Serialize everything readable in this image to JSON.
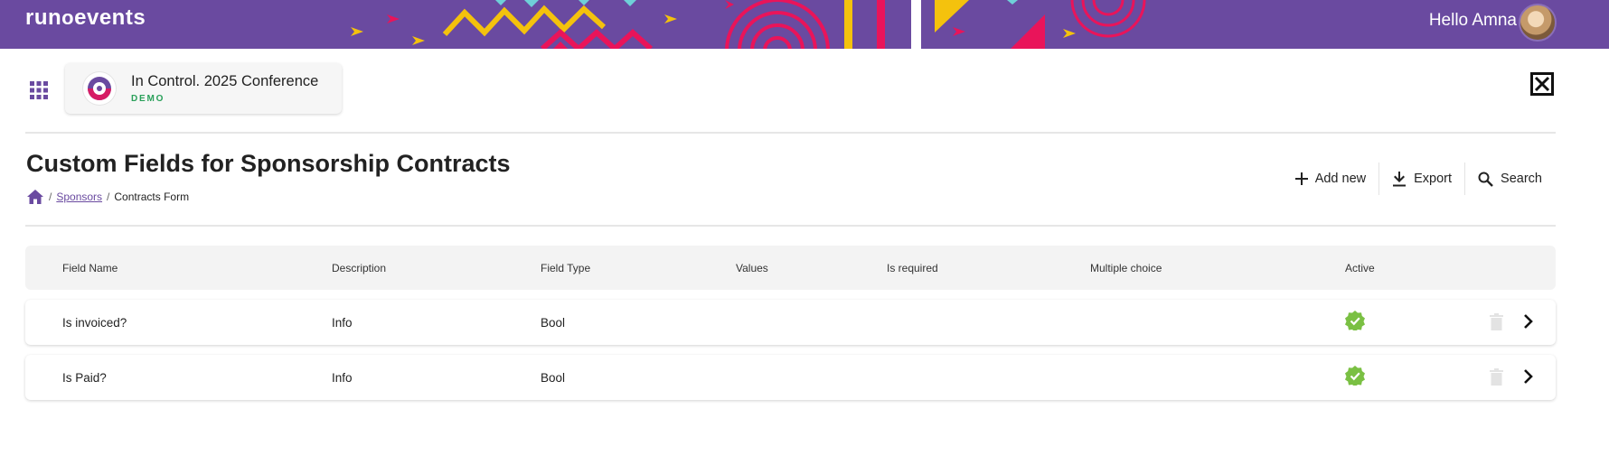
{
  "header": {
    "logo_left": "run",
    "logo_sep": "o",
    "logo_right": "events",
    "greeting": "Hello Amna",
    "brand_color": "#6a4aa0"
  },
  "event": {
    "name": "In Control. 2025 Conference",
    "badge": "DEMO"
  },
  "page": {
    "title": "Custom Fields for Sponsorship Contracts",
    "breadcrumb": {
      "link": "Sponsors",
      "current": "Contracts Form"
    }
  },
  "toolbar": {
    "add_label": "Add new",
    "export_label": "Export",
    "search_label": "Search"
  },
  "table": {
    "columns": [
      "Field Name",
      "Description",
      "Field Type",
      "Values",
      "Is required",
      "Multiple choice",
      "Active"
    ],
    "rows": [
      {
        "field_name": "Is invoiced?",
        "description": "Info",
        "field_type": "Bool",
        "values": "",
        "is_required": "",
        "multiple_choice": "",
        "active": true
      },
      {
        "field_name": "Is Paid?",
        "description": "Info",
        "field_type": "Bool",
        "values": "",
        "is_required": "",
        "multiple_choice": "",
        "active": true
      }
    ],
    "active_color": "#7ac043"
  },
  "icons": {
    "apps": "apps-grid-icon",
    "close": "close-box-icon",
    "home": "home-icon",
    "add": "plus-icon",
    "export": "download-icon",
    "search": "search-icon",
    "active": "verified-check-icon",
    "delete": "trash-icon",
    "open": "chevron-right-icon"
  }
}
